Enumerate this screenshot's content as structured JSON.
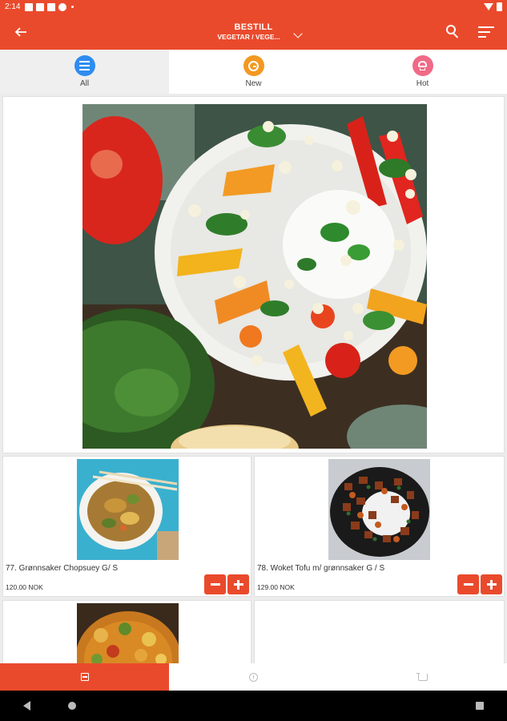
{
  "status_bar": {
    "time": "2:14"
  },
  "app_bar": {
    "title": "BESTILL",
    "subtitle": "VEGETAR / VEGE...",
    "icons": [
      "back-arrow-icon",
      "chevron-down-icon",
      "search-icon",
      "sort-icon"
    ]
  },
  "tabs": [
    {
      "label": "All",
      "icon": "list-icon",
      "color": "#2f8cf0",
      "active": true
    },
    {
      "label": "New",
      "icon": "clock-icon",
      "color": "#f39821",
      "active": false
    },
    {
      "label": "Hot",
      "icon": "chef-hat-icon",
      "color": "#f06a86",
      "active": false
    }
  ],
  "items": [
    {
      "name": "77. Grønnsaker Chopsuey G/ S",
      "price": "120.00 NOK"
    },
    {
      "name": "78. Woket Tofu m/ grønnsaker G / S",
      "price": "129.00 NOK"
    }
  ],
  "bottom_nav": [
    {
      "icon": "menu-icon",
      "active": true
    },
    {
      "icon": "clock-icon",
      "active": false
    },
    {
      "icon": "cart-icon",
      "active": false
    }
  ],
  "colors": {
    "accent": "#ea4a2c",
    "tab_all": "#2f8cf0",
    "tab_new": "#f39821",
    "tab_hot": "#f06a86"
  }
}
